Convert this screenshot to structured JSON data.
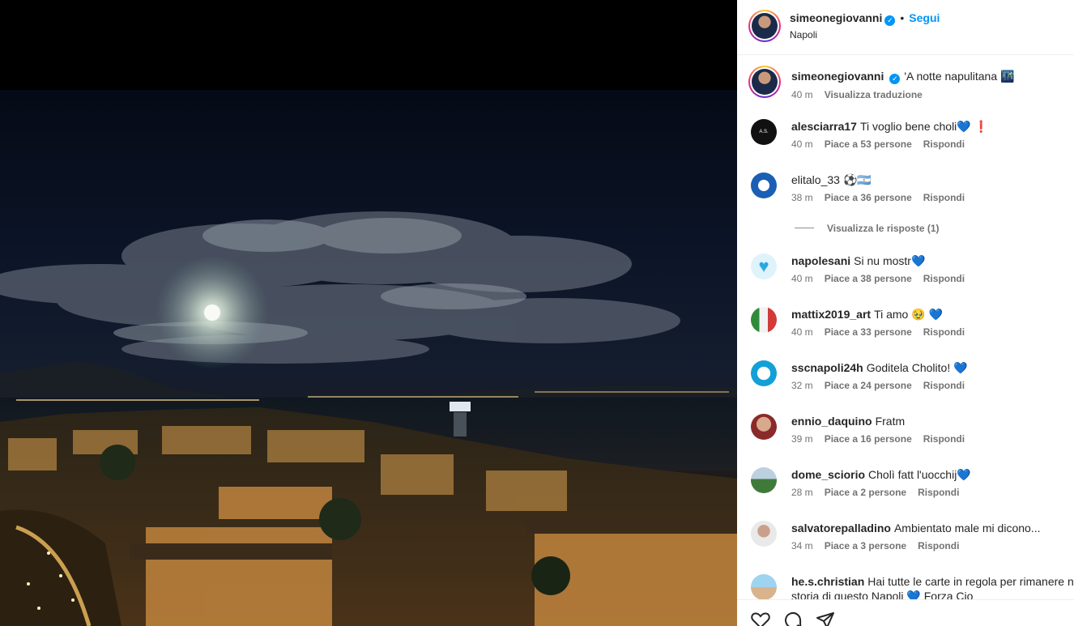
{
  "post": {
    "author": "simeonegiovanni",
    "location": "Napoli",
    "follow_label": "Segui",
    "separator": "•",
    "verified_mark": "✓",
    "caption": "'A notte napulitana 🌃",
    "caption_time": "40 m",
    "translate_label": "Visualizza traduzione"
  },
  "comments": [
    {
      "user": "alesciarra17",
      "text": "Ti voglio bene choli",
      "emoji1": "💙",
      "emoji2": "❗",
      "time": "40 m",
      "likes": "Piace a 53 persone",
      "reply": "Rispondi",
      "avatar": "as-avatar"
    },
    {
      "user": "elitalo_33",
      "text": "⚽🇦🇷",
      "time": "38 m",
      "likes": "Piace a 36 persone",
      "reply": "Rispondi",
      "avatar": "badge-avatar"
    },
    {
      "user": "napolesani",
      "text": "Si nu mostr",
      "emoji1": "💙",
      "time": "40 m",
      "likes": "Piace a 38 persone",
      "reply": "Rispondi",
      "avatar": "heart-avatar"
    },
    {
      "user": "mattix2019_art",
      "text": "Ti amo 🥹",
      "emoji1": "💙",
      "time": "40 m",
      "likes": "Piace a 33 persone",
      "reply": "Rispondi",
      "avatar": "photo-avatar"
    },
    {
      "user": "sscnapoli24h",
      "text": "Goditela Cholito!",
      "emoji1": "💙",
      "time": "32 m",
      "likes": "Piace a 24 persone",
      "reply": "Rispondi",
      "avatar": "napoli-avatar"
    },
    {
      "user": "ennio_daquino",
      "text": "Fratm",
      "time": "39 m",
      "likes": "Piace a 16 persone",
      "reply": "Rispondi",
      "avatar": "selfie-avatar"
    },
    {
      "user": "dome_sciorio",
      "text": "Cholì fatt l'uocchij",
      "emoji1": "💙",
      "time": "28 m",
      "likes": "Piace a 2 persone",
      "reply": "Rispondi",
      "avatar": "field-avatar"
    },
    {
      "user": "salvatorepalladino",
      "text": "Ambientato male mi dicono...",
      "time": "34 m",
      "likes": "Piace a 3 persone",
      "reply": "Rispondi",
      "avatar": "man-avatar"
    },
    {
      "user": "he.s.christian",
      "text": "Hai tutte le carte in regola per rimanere nella",
      "text2": "storia di questo Napoli 💙 Forza Cio",
      "avatar": "beach-avatar"
    }
  ],
  "replies_label": "Visualizza le risposte (1)",
  "icons": [
    "heart-icon",
    "comment-icon",
    "share-icon"
  ]
}
